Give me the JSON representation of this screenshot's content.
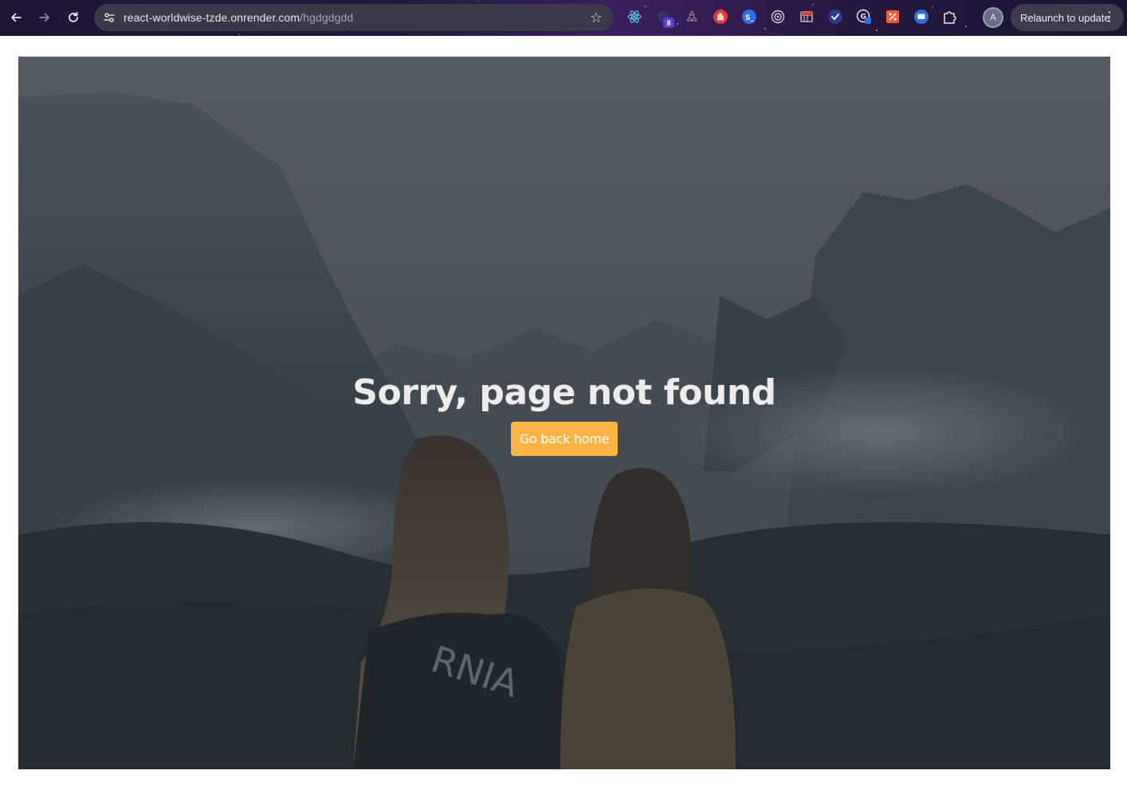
{
  "browser": {
    "url_host": "react-worldwise-tzde.onrender.com",
    "url_path": "/hgdgdgdd",
    "extension_badge": "8",
    "profile_initial": "A",
    "relaunch_label": "Relaunch to update",
    "extensions": [
      {
        "name": "react-devtools-icon",
        "color": "#58c4dc"
      },
      {
        "name": "extension-purple-icon",
        "color": "#5b3fd1"
      },
      {
        "name": "recycle-icon",
        "color": "#8c8aa0"
      },
      {
        "name": "stop-hand-icon",
        "color": "#e53935"
      },
      {
        "name": "terminal-extension-icon",
        "color": "#2f6fe4"
      },
      {
        "name": "target-icon",
        "color": "#d7d6de"
      },
      {
        "name": "screen-grid-icon",
        "color": "#d7d6de"
      },
      {
        "name": "check-badge-icon",
        "color": "#2b3a8f"
      },
      {
        "name": "translate-icon",
        "color": "#e9e8ef"
      },
      {
        "name": "percent-tag-icon",
        "color": "#ff5a36"
      },
      {
        "name": "chat-icon",
        "color": "#2f6fe4"
      },
      {
        "name": "puzzle-icon",
        "color": "#e9e8ef"
      }
    ]
  },
  "page": {
    "title": "Sorry, page not found",
    "cta_label": "Go back home",
    "accent_color": "#ffb545"
  }
}
